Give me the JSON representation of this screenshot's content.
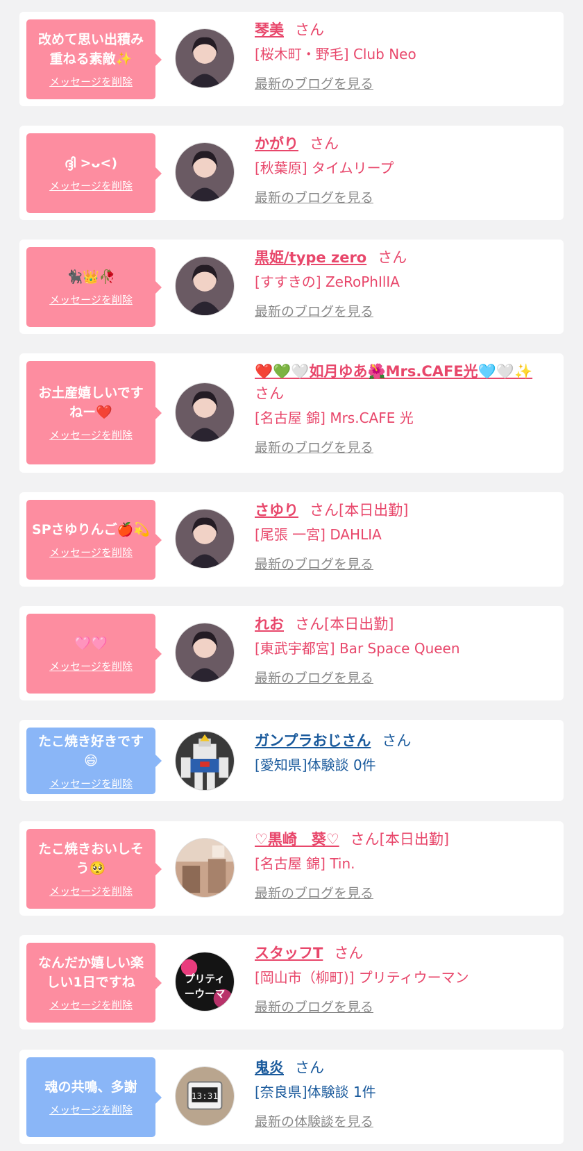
{
  "colors": {
    "pink_bubble": "#fd8da0",
    "blue_bubble": "#8ab6f7",
    "pink_text": "#e8476b",
    "blue_text": "#1a5a9c",
    "gray_link": "#888888"
  },
  "items": [
    {
      "theme": "pink",
      "message": "改めて思い出積み重ねる素敵✨",
      "delete_label": "メッセージを削除",
      "name": "琴美",
      "honorific": "さん",
      "shop": "[桜木町・野毛] Club Neo",
      "link": "最新のブログを見る",
      "avatar": "portrait-avatar"
    },
    {
      "theme": "pink",
      "message": "ദ്ദി >ᴗ<)",
      "delete_label": "メッセージを削除",
      "name": "かがり",
      "honorific": "さん",
      "shop": "[秋葉原] タイムリープ",
      "link": "最新のブログを見る",
      "avatar": "portrait-avatar"
    },
    {
      "theme": "pink",
      "message": "🐈‍⬛👑🥀",
      "delete_label": "メッセージを削除",
      "name": "黒姫/type zero",
      "honorific": "さん",
      "shop": "[すすきの] ZeRoPhIlIA",
      "link": "最新のブログを見る",
      "avatar": "portrait-avatar"
    },
    {
      "theme": "pink",
      "message": "お土産嬉しいですねー❤️",
      "delete_label": "メッセージを削除",
      "name": "❤️💚🤍如月ゆあ🌺Mrs.CAFE光🩵🤍✨",
      "honorific": "さん",
      "shop": "[名古屋 錦] Mrs.CAFE 光",
      "link": "最新のブログを見る",
      "avatar": "portrait-avatar"
    },
    {
      "theme": "pink",
      "message": "SPさゆりんご🍎💫",
      "delete_label": "メッセージを削除",
      "name": "さゆり",
      "honorific": "さん[本日出勤]",
      "shop": "[尾張 一宮] DAHLIA",
      "link": "最新のブログを見る",
      "avatar": "portrait-avatar"
    },
    {
      "theme": "pink",
      "message": "🩷🩷",
      "delete_label": "メッセージを削除",
      "name": "れお",
      "honorific": "さん[本日出勤]",
      "shop": "[東武宇都宮] Bar Space Queen",
      "link": "最新のブログを見る",
      "avatar": "portrait-avatar"
    },
    {
      "theme": "blue",
      "message": "たこ焼き好きです😄",
      "delete_label": "メッセージを削除",
      "name": "ガンプラおじさん",
      "honorific": "さん",
      "shop": "[愛知県]体験談 0件",
      "link": "",
      "avatar": "robot-avatar"
    },
    {
      "theme": "pink",
      "message": "たこ焼きおいしそう🥺",
      "delete_label": "メッセージを削除",
      "name": "♡黒崎　葵♡",
      "honorific": "さん[本日出勤]",
      "shop": "[名古屋 錦] Tin.",
      "link": "最新のブログを見る",
      "avatar": "room-avatar"
    },
    {
      "theme": "pink",
      "message": "なんだか嬉しい楽しい1日ですね",
      "delete_label": "メッセージを削除",
      "name": "スタッフT",
      "honorific": "さん",
      "shop": "[岡山市（柳町)] プリティウーマン",
      "link": "最新のブログを見る",
      "avatar": "logo-avatar",
      "avatar_text": "プリティーウーマ"
    },
    {
      "theme": "blue",
      "message": "魂の共鳴、多謝",
      "delete_label": "メッセージを削除",
      "name": "鬼炎",
      "honorific": "さん",
      "shop": "[奈良県]体験談 1件",
      "link": "最新の体験談を見る",
      "avatar": "clock-avatar",
      "avatar_text": "13:31"
    }
  ]
}
